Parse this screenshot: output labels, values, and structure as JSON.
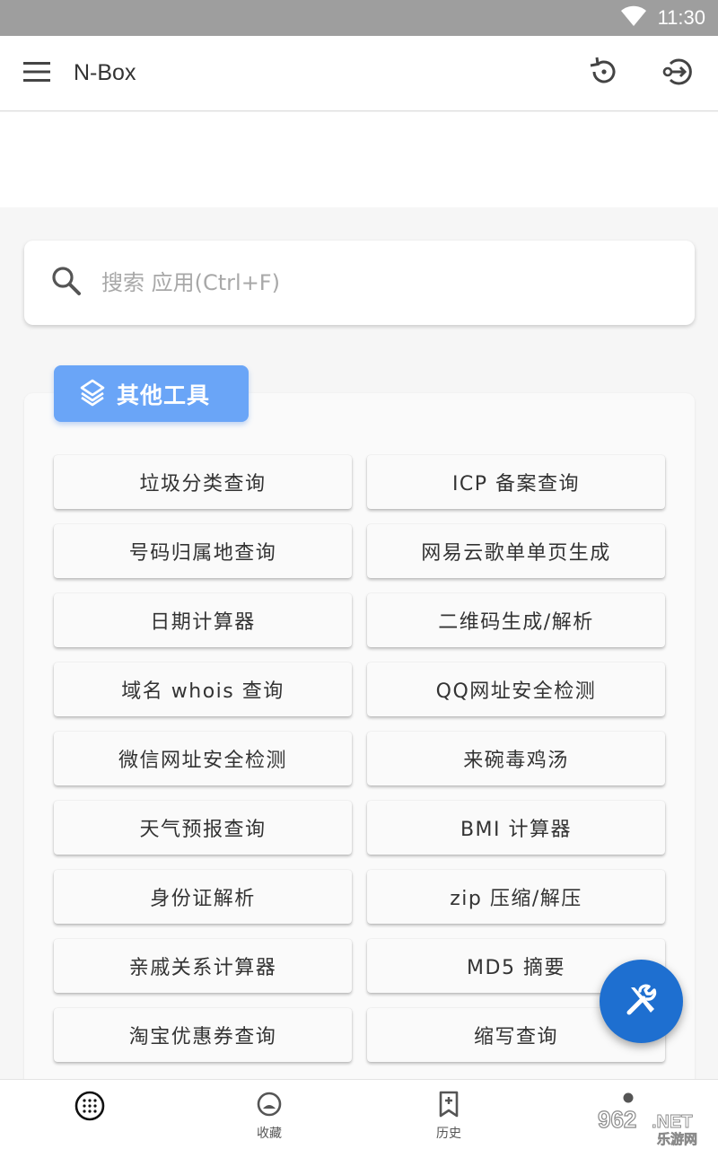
{
  "status_bar": {
    "time": "11:30"
  },
  "app_bar": {
    "title": "N-Box"
  },
  "search": {
    "placeholder": "搜索 应用(Ctrl+F)"
  },
  "section": {
    "title": "其他工具"
  },
  "tools": [
    "垃圾分类查询",
    "ICP 备案查询",
    "号码归属地查询",
    "网易云歌单单页生成",
    "日期计算器",
    "二维码生成/解析",
    "域名 whois 查询",
    "QQ网址安全检测",
    "微信网址安全检测",
    "来碗毒鸡汤",
    "天气预报查询",
    "BMI 计算器",
    "身份证解析",
    "zip 压缩/解压",
    "亲戚关系计算器",
    "MD5 摘要",
    "淘宝优惠券查询",
    "缩写查询"
  ],
  "bottom_nav": {
    "items": [
      {
        "label": "",
        "icon": "apps-grid-icon"
      },
      {
        "label": "收藏",
        "icon": "favorite-icon"
      },
      {
        "label": "历史",
        "icon": "history-bookmark-icon"
      },
      {
        "label": "",
        "icon": "account-icon"
      }
    ]
  },
  "watermark": {
    "text": "962.NET 乐游网"
  },
  "colors": {
    "status_bar": "#9e9e9e",
    "section_badge": "#6aa5f7",
    "fab": "#1e6fd0"
  }
}
